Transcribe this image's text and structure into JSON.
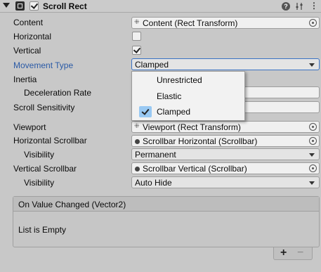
{
  "header": {
    "title": "Scroll Rect",
    "enabled": true
  },
  "fields": {
    "content": {
      "label": "Content",
      "value": "Content (Rect Transform)"
    },
    "horizontal": {
      "label": "Horizontal",
      "checked": false
    },
    "vertical": {
      "label": "Vertical",
      "checked": true
    },
    "movement_type": {
      "label": "Movement Type",
      "value": "Clamped"
    },
    "inertia": {
      "label": "Inertia"
    },
    "deceleration_rate": {
      "label": "Deceleration Rate"
    },
    "scroll_sensitivity": {
      "label": "Scroll Sensitivity"
    },
    "viewport": {
      "label": "Viewport",
      "value": "Viewport (Rect Transform)"
    },
    "horizontal_scrollbar": {
      "label": "Horizontal Scrollbar",
      "value": "Scrollbar Horizontal (Scrollbar)"
    },
    "h_visibility": {
      "label": "Visibility",
      "value": "Permanent"
    },
    "vertical_scrollbar": {
      "label": "Vertical Scrollbar",
      "value": "Scrollbar Vertical (Scrollbar)"
    },
    "v_visibility": {
      "label": "Visibility",
      "value": "Auto Hide"
    }
  },
  "menu": {
    "items": [
      {
        "label": "Unrestricted",
        "selected": false
      },
      {
        "label": "Elastic",
        "selected": false
      },
      {
        "label": "Clamped",
        "selected": true
      }
    ]
  },
  "event": {
    "title": "On Value Changed (Vector2)",
    "empty_text": "List is Empty",
    "add_label": "+",
    "remove_label": "−"
  },
  "header_icons": {
    "help": "?"
  }
}
